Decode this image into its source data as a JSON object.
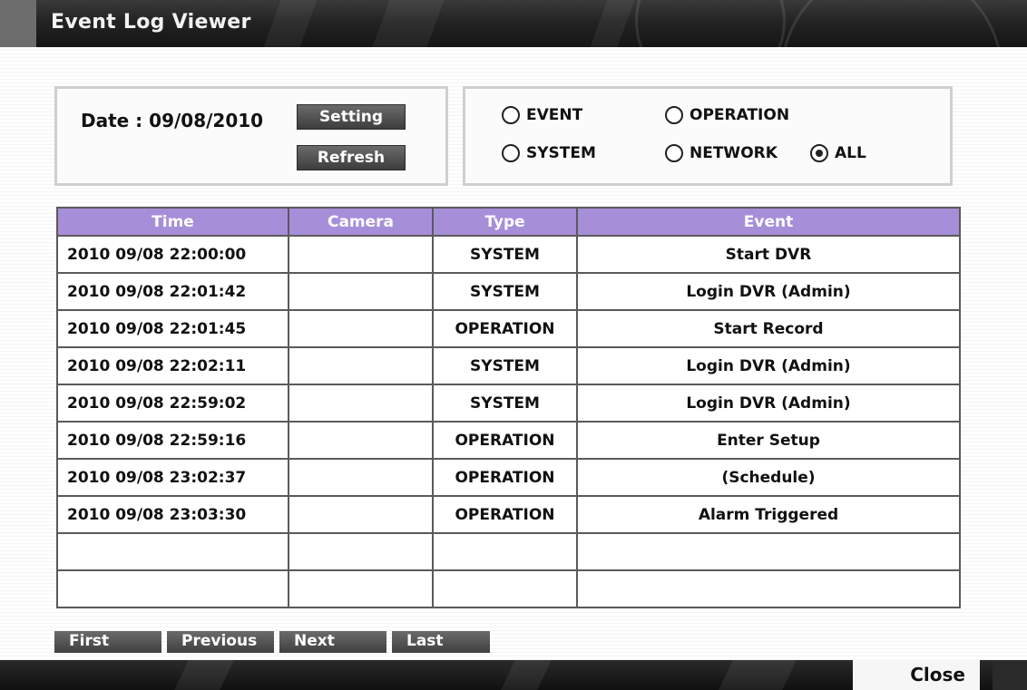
{
  "window": {
    "title": "Event Log Viewer"
  },
  "date": {
    "label": "Date : 09/08/2010",
    "setting_label": "Setting",
    "refresh_label": "Refresh"
  },
  "filters": {
    "event": "EVENT",
    "operation": "OPERATION",
    "system": "SYSTEM",
    "network": "NETWORK",
    "all": "ALL",
    "selected": "ALL"
  },
  "table": {
    "headers": {
      "time": "Time",
      "camera": "Camera",
      "type": "Type",
      "event": "Event"
    },
    "header_color": "#a78ed9",
    "rows": [
      {
        "time": "2010 09/08 22:00:00",
        "camera": "",
        "type": "SYSTEM",
        "event": "Start DVR"
      },
      {
        "time": "2010 09/08 22:01:42",
        "camera": "",
        "type": "SYSTEM",
        "event": "Login DVR (Admin)"
      },
      {
        "time": "2010 09/08 22:01:45",
        "camera": "",
        "type": "OPERATION",
        "event": "Start Record"
      },
      {
        "time": "2010 09/08 22:02:11",
        "camera": "",
        "type": "SYSTEM",
        "event": "Login DVR (Admin)"
      },
      {
        "time": "2010 09/08 22:59:02",
        "camera": "",
        "type": "SYSTEM",
        "event": "Login DVR (Admin)"
      },
      {
        "time": "2010 09/08 22:59:16",
        "camera": "",
        "type": "OPERATION",
        "event": "Enter Setup"
      },
      {
        "time": "2010 09/08 23:02:37",
        "camera": "",
        "type": "OPERATION",
        "event": "(Schedule)"
      },
      {
        "time": "2010 09/08 23:03:30",
        "camera": "",
        "type": "OPERATION",
        "event": "Alarm Triggered"
      },
      {
        "time": "",
        "camera": "",
        "type": "",
        "event": ""
      },
      {
        "time": "",
        "camera": "",
        "type": "",
        "event": ""
      }
    ]
  },
  "pager": {
    "first": "First",
    "previous": "Previous",
    "next": "Next",
    "last": "Last"
  },
  "footer": {
    "close_label": "Close"
  }
}
